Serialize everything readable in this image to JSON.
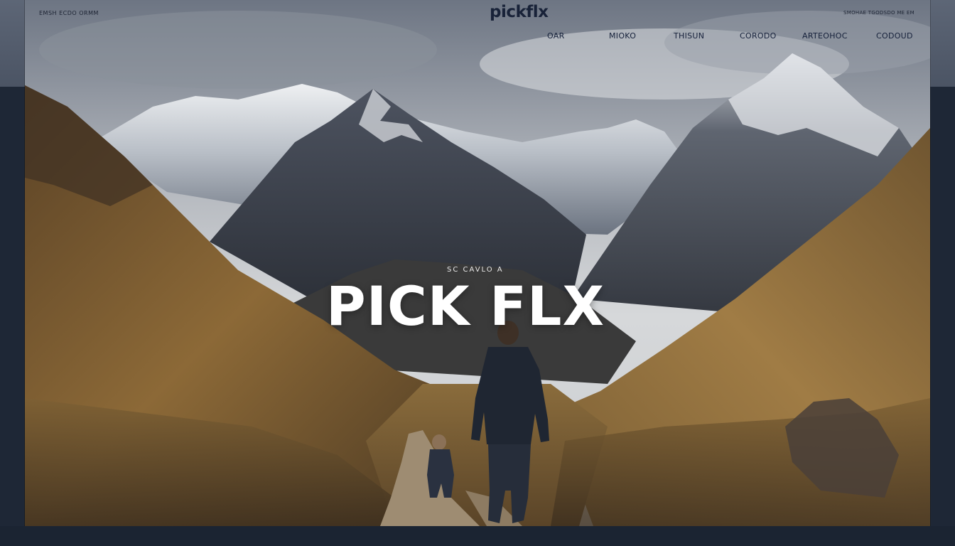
{
  "header": {
    "tagline": "EMSH ECDO ORMM",
    "logo": "pickflx",
    "utility": "SMOHAE TGODSDO ME EM"
  },
  "nav": {
    "items": [
      {
        "label": "OAR"
      },
      {
        "label": "MIOKO"
      },
      {
        "label": "THISUN"
      },
      {
        "label": "CORODO"
      },
      {
        "label": "ARTEOHOC"
      },
      {
        "label": "CODOUD"
      }
    ]
  },
  "hero": {
    "eyebrow": "SC CAVLO A",
    "title": "PICK FLX"
  },
  "colors": {
    "backdrop": "#1e2736",
    "nav_text": "#15203a",
    "hero_title": "#ffffff"
  }
}
